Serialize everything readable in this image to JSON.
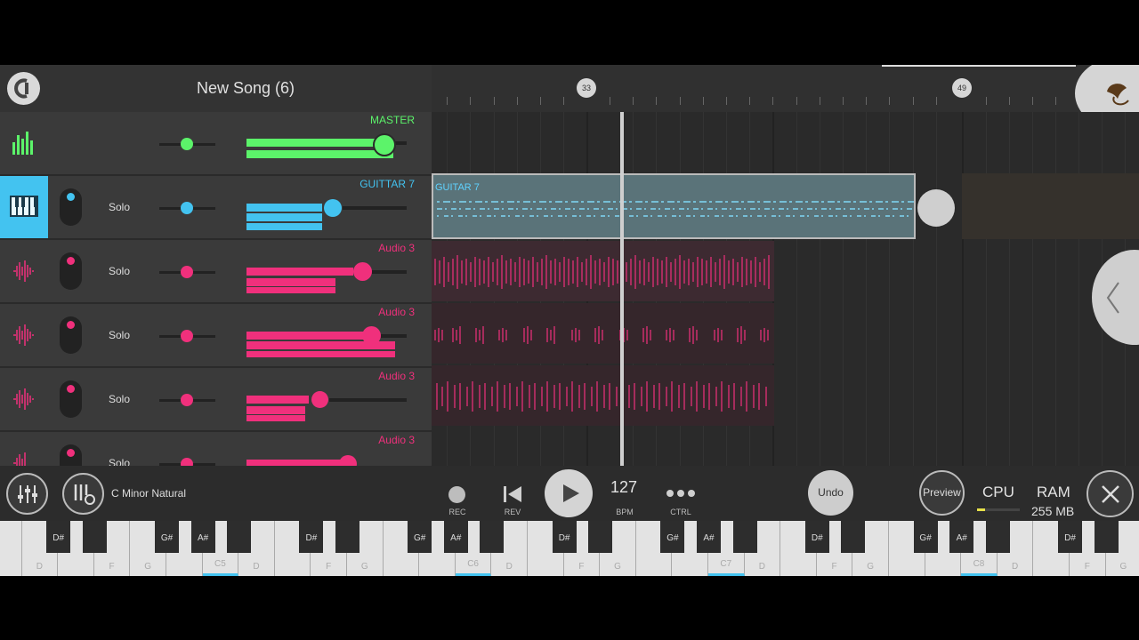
{
  "header": {
    "song_title": "New Song (6)"
  },
  "timeline": {
    "markers": [
      "33",
      "49"
    ]
  },
  "tracks": [
    {
      "name": "MASTER",
      "color": "#5cf36a"
    },
    {
      "name": "GUITTAR 7",
      "color": "#43c3f0",
      "solo": "Solo"
    },
    {
      "name": "Audio 3",
      "color": "#f0307c",
      "solo": "Solo"
    },
    {
      "name": "Audio 3",
      "color": "#f0307c",
      "solo": "Solo"
    },
    {
      "name": "Audio 3",
      "color": "#f0307c",
      "solo": "Solo"
    },
    {
      "name": "Audio 3",
      "color": "#f0307c",
      "solo": "Solo"
    }
  ],
  "clips": {
    "guitar_label": "GUITAR 7"
  },
  "transport": {
    "scale": "C Minor Natural",
    "rec": "REC",
    "rev": "REV",
    "tempo": "127",
    "bpm": "BPM",
    "ctrl": "CTRL",
    "undo": "Undo",
    "preview": "Preview",
    "cpu": "CPU",
    "ram": "RAM",
    "ram_value": "255 MB"
  },
  "keyboard": {
    "white_labels": [
      "",
      "D",
      "",
      "F",
      "G",
      "",
      "C5",
      "D",
      "",
      "F",
      "G",
      "",
      "",
      "C6",
      "D",
      "",
      "F",
      "G",
      "",
      "",
      "C7",
      "D",
      "",
      "F",
      "G",
      "",
      "",
      "C8",
      "D",
      "",
      "F",
      "G"
    ],
    "black_labels": [
      "D#",
      "",
      "G#",
      "A#",
      "",
      "D#",
      "",
      "G#",
      "A#",
      "",
      "D#",
      "",
      "G#",
      "A#",
      "",
      "D#",
      "",
      "G#",
      "A#",
      "",
      "D#",
      "",
      "G#",
      "A#",
      "",
      "D#",
      "",
      "G#",
      "A#"
    ]
  },
  "colors": {
    "master": "#5cf36a",
    "guitar": "#43c3f0",
    "audio": "#f0307c"
  }
}
